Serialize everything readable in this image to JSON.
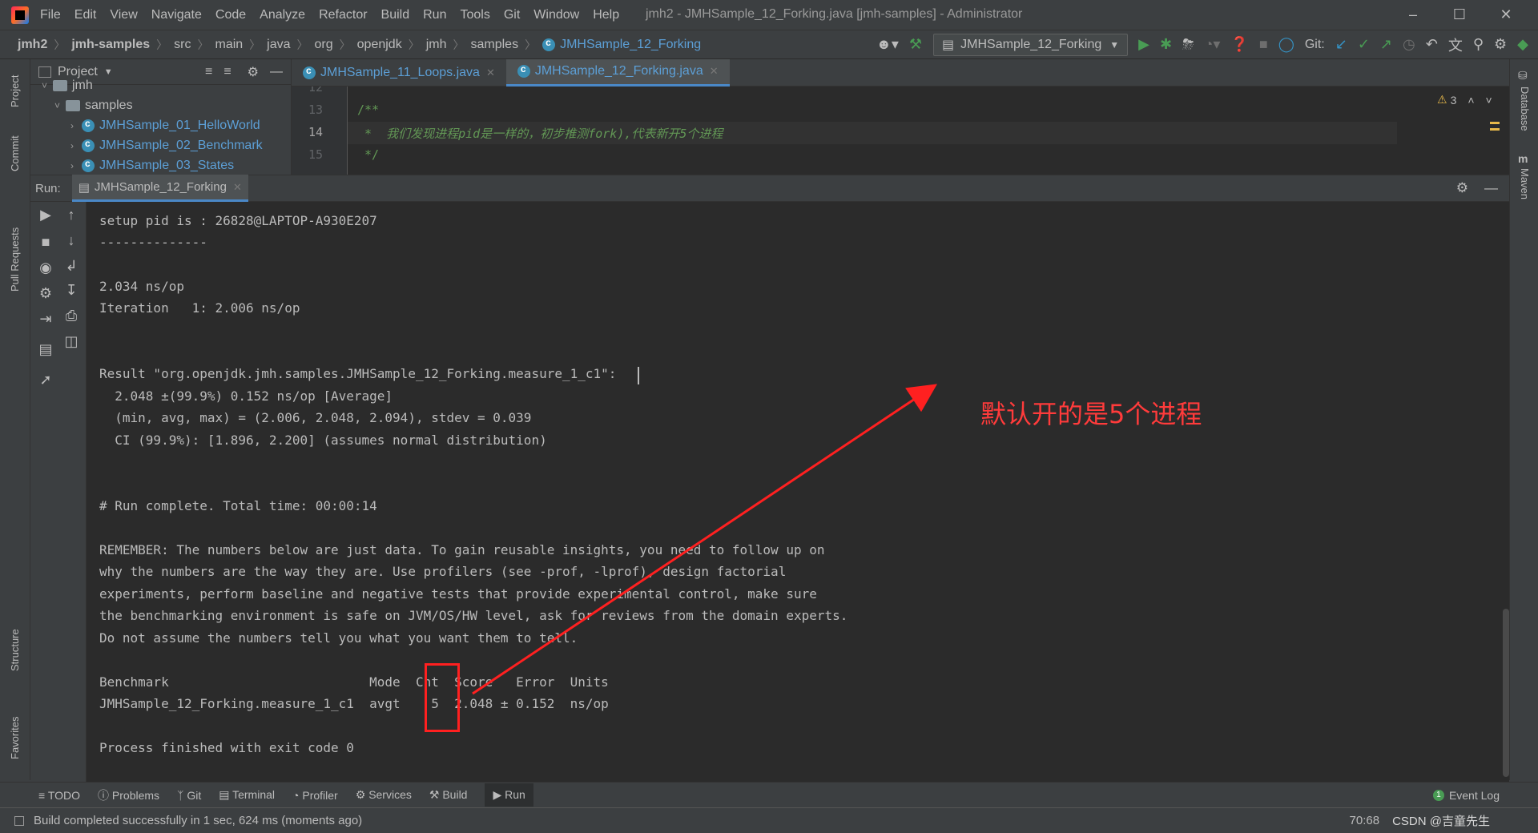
{
  "menubar": {
    "items": [
      "File",
      "Edit",
      "View",
      "Navigate",
      "Code",
      "Analyze",
      "Refactor",
      "Build",
      "Run",
      "Tools",
      "Git",
      "Window",
      "Help"
    ],
    "title": "jmh2 - JMHSample_12_Forking.java [jmh-samples] - Administrator"
  },
  "navbar": {
    "breadcrumbs": [
      "jmh2",
      "jmh-samples",
      "src",
      "main",
      "java",
      "org",
      "openjdk",
      "jmh",
      "samples",
      "JMHSample_12_Forking"
    ],
    "run_config": "JMHSample_12_Forking",
    "git_label": "Git:"
  },
  "left_stripe": {
    "project": "Project",
    "commit": "Commit",
    "pull_requests": "Pull Requests",
    "structure": "Structure",
    "favorites": "Favorites"
  },
  "right_stripe": {
    "database": "Database",
    "maven": "Maven"
  },
  "project_panel": {
    "title": "Project",
    "items": [
      {
        "label": "jmh",
        "kind": "folder"
      },
      {
        "label": "samples",
        "kind": "folder"
      },
      {
        "label": "JMHSample_01_HelloWorld",
        "kind": "class"
      },
      {
        "label": "JMHSample_02_Benchmark",
        "kind": "class"
      },
      {
        "label": "JMHSample_03_States",
        "kind": "class"
      }
    ]
  },
  "editor": {
    "tabs": [
      {
        "label": "JMHSample_11_Loops.java",
        "active": false
      },
      {
        "label": "JMHSample_12_Forking.java",
        "active": true
      }
    ],
    "lines": [
      {
        "num": "12",
        "text": ""
      },
      {
        "num": "13",
        "text": "/**"
      },
      {
        "num": "14",
        "text": " *  我们发现进程pid是一样的，初步推测fork),代表新开5个进程"
      },
      {
        "num": "15",
        "text": " */"
      }
    ],
    "warnings": "3"
  },
  "run_panel": {
    "label": "Run:",
    "tab": "JMHSample_12_Forking",
    "lines": [
      "setup pid is : 26828@LAPTOP-A930E207",
      "--------------",
      "",
      "2.034 ns/op",
      "Iteration   1: 2.006 ns/op",
      "",
      "",
      "Result \"org.openjdk.jmh.samples.JMHSample_12_Forking.measure_1_c1\":",
      "  2.048 ±(99.9%) 0.152 ns/op [Average]",
      "  (min, avg, max) = (2.006, 2.048, 2.094), stdev = 0.039",
      "  CI (99.9%): [1.896, 2.200] (assumes normal distribution)",
      "",
      "",
      "# Run complete. Total time: 00:00:14",
      "",
      "REMEMBER: The numbers below are just data. To gain reusable insights, you need to follow up on",
      "why the numbers are the way they are. Use profilers (see -prof, -lprof), design factorial",
      "experiments, perform baseline and negative tests that provide experimental control, make sure",
      "the benchmarking environment is safe on JVM/OS/HW level, ask for reviews from the domain experts.",
      "Do not assume the numbers tell you what you want them to tell.",
      "",
      "Benchmark                          Mode  Cnt  Score   Error  Units",
      "JMHSample_12_Forking.measure_1_c1  avgt    5  2.048 ± 0.152  ns/op",
      "",
      "Process finished with exit code 0"
    ]
  },
  "annotation": {
    "text": "默认开的是5个进程",
    "color": "#ff2020"
  },
  "bottom_bar": {
    "tabs": [
      "TODO",
      "Problems",
      "Git",
      "Terminal",
      "Profiler",
      "Services",
      "Build",
      "Run"
    ],
    "event_log": "Event Log"
  },
  "status_bar": {
    "message": "Build completed successfully in 1 sec, 624 ms (moments ago)",
    "position": "70:68",
    "watermark": "CSDN @吉童先生"
  },
  "colors": {
    "accent": "#4a88c7",
    "run_green": "#499c54",
    "annotation_red": "#ff2020"
  }
}
